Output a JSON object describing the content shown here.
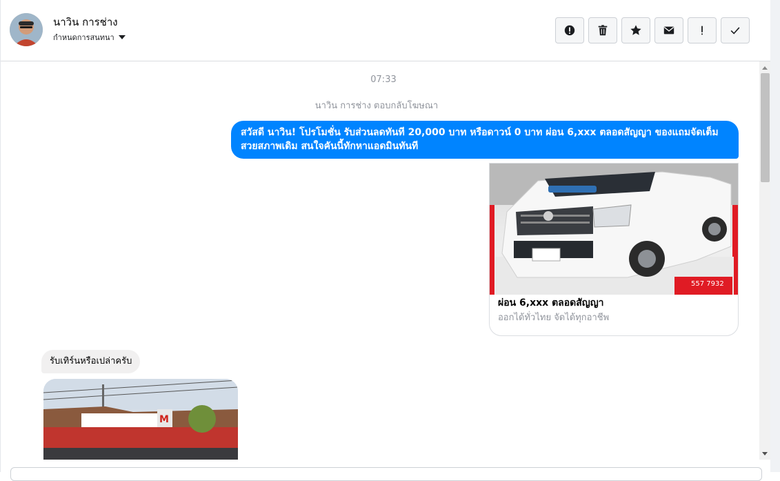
{
  "header": {
    "contact_name": "นาวิน การช่าง",
    "assign_label": "กำหนดการสนทนา",
    "actions": [
      {
        "id": "report",
        "icon": "alert-circle-icon"
      },
      {
        "id": "delete",
        "icon": "trash-icon"
      },
      {
        "id": "star",
        "icon": "star-icon"
      },
      {
        "id": "mark-unread",
        "icon": "envelope-icon"
      },
      {
        "id": "important",
        "icon": "exclamation-icon"
      },
      {
        "id": "done",
        "icon": "check-icon"
      }
    ]
  },
  "chat": {
    "timestamp": "07:33",
    "ad_reply_note": "นาวิน การช่าง ตอบกลับโฆษณา",
    "outgoing_message": "สวัสดี นาวิน! โปรโมชั่น รับส่วนลดทันที 20,000 บาท หรือดาวน์ 0 บาท ผ่อน 6,xxx ตลอดสัญญา ของแถมจัดเต็ม สวยสภาพเดิม สนใจคันนี้ทักหาแอดมินทันที",
    "card": {
      "title": "ผ่อน 6,xxx ตลอดสัญญา",
      "subtitle": "ออกได้ทั่วไทย จัดได้ทุกอาชีพ",
      "image_icon": "pickup-truck-photo",
      "image_phone": "557 7932"
    },
    "incoming_message": "รับเทิร์นหรือเปล่าครับ",
    "incoming_image_icon": "car-dealership-photo"
  },
  "colors": {
    "outgoing_bubble": "#0084ff",
    "incoming_bubble": "#f1f0f0",
    "muted_text": "#90949c"
  }
}
